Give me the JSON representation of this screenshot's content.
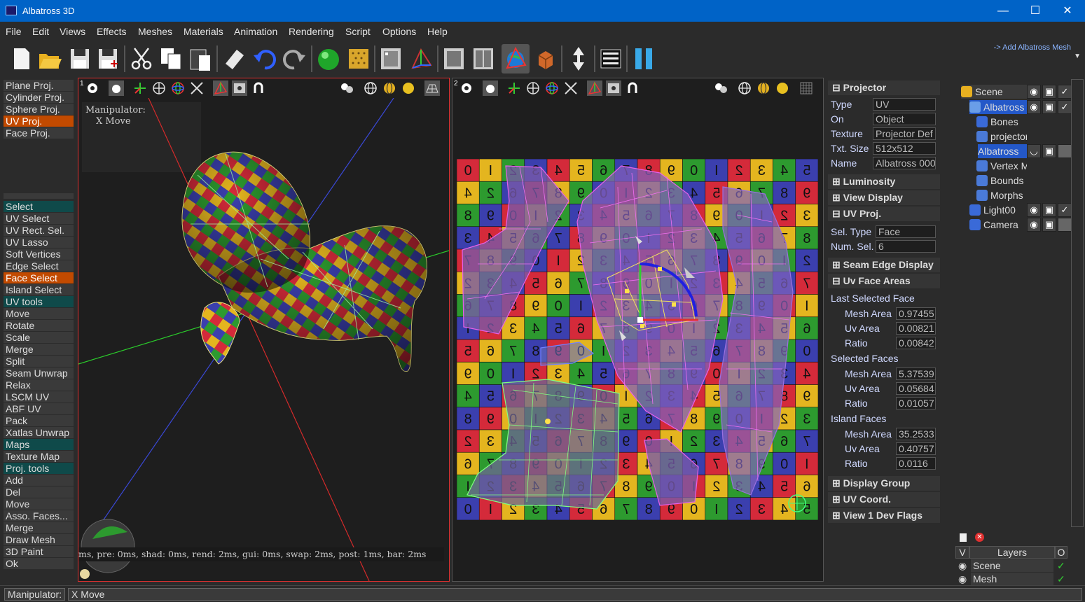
{
  "window": {
    "title": "Albatross 3D",
    "minimize": "—",
    "maximize": "☐",
    "close": "✕"
  },
  "menu": [
    "File",
    "Edit",
    "Views",
    "Effects",
    "Meshes",
    "Materials",
    "Animation",
    "Rendering",
    "Script",
    "Options",
    "Help"
  ],
  "toolbar": {
    "add_mesh_link": "-> Add Albatross Mesh",
    "overflow_arrow": "▼"
  },
  "left_panel": {
    "proj_items": [
      "Plane Proj.",
      "Cylinder Proj.",
      "Sphere Proj.",
      "UV Proj.",
      "Face Proj."
    ],
    "proj_selected": "UV Proj.",
    "select_header": "Select",
    "select_items": [
      "UV Select",
      "UV Rect. Sel.",
      "UV Lasso",
      "Soft Vertices",
      "Edge Select",
      "Face Select",
      "Island Select"
    ],
    "select_selected": "Face Select",
    "uvtools_header": "UV tools",
    "uvtools_items": [
      "Move",
      "Rotate",
      "Scale",
      "Merge",
      "Split",
      "Seam Unwrap",
      "Relax",
      "LSCM UV",
      "ABF UV",
      "Pack",
      "Xatlas Unwrap"
    ],
    "maps_header": "Maps",
    "maps_items": [
      "Texture Map"
    ],
    "projtools_header": "Proj. tools",
    "projtools_items": [
      "Add",
      "Del",
      "Move",
      "Asso. Faces...",
      "Merge",
      "Draw Mesh",
      "3D Paint",
      "Ok"
    ]
  },
  "viewport1": {
    "number": "1",
    "manipulator_label": "Manipulator:",
    "manipulator_value": "X Move",
    "timing": "ms, pre: 0ms, shad: 0ms, rend: 2ms, gui: 0ms, swap: 2ms, post: 1ms, bar: 2ms"
  },
  "viewport2": {
    "number": "2",
    "uv_grid_rows": [
      [
        "0",
        "I",
        "2",
        "3",
        "4",
        "5",
        "6",
        "7",
        "8",
        "9",
        "0",
        "I",
        "2",
        "3",
        "4",
        "5"
      ],
      [
        "4",
        "2",
        "6",
        "7",
        "8",
        "9",
        "0",
        "I",
        "2",
        "3",
        "4",
        "5",
        "6",
        "7",
        "8",
        "9"
      ],
      [
        "8",
        "9",
        "0",
        "I",
        "2",
        "3",
        "4",
        "5",
        "6",
        "7",
        "8",
        "9",
        "0",
        "I",
        "2",
        "3"
      ],
      [
        "3",
        "4",
        "5",
        "6",
        "7",
        "8",
        "9",
        "0",
        "I",
        "2",
        "3",
        "4",
        "5",
        "6",
        "7",
        "8"
      ],
      [
        "7",
        "8",
        "9",
        "0",
        "I",
        "2",
        "3",
        "4",
        "5",
        "6",
        "7",
        "8",
        "9",
        "0",
        "I",
        "2"
      ],
      [
        "2",
        "3",
        "4",
        "5",
        "6",
        "7",
        "8",
        "9",
        "0",
        "I",
        "2",
        "3",
        "4",
        "5",
        "6",
        "7"
      ],
      [
        "6",
        "7",
        "8",
        "9",
        "0",
        "I",
        "2",
        "3",
        "4",
        "5",
        "6",
        "7",
        "8",
        "9",
        "0",
        "I"
      ],
      [
        "I",
        "2",
        "3",
        "4",
        "5",
        "6",
        "7",
        "8",
        "9",
        "0",
        "I",
        "2",
        "3",
        "4",
        "5",
        "6"
      ],
      [
        "5",
        "6",
        "7",
        "8",
        "9",
        "0",
        "I",
        "2",
        "3",
        "4",
        "5",
        "6",
        "7",
        "8",
        "9",
        "0"
      ],
      [
        "9",
        "0",
        "I",
        "2",
        "3",
        "4",
        "5",
        "6",
        "7",
        "8",
        "9",
        "0",
        "I",
        "2",
        "3",
        "4"
      ],
      [
        "4",
        "5",
        "6",
        "7",
        "8",
        "9",
        "0",
        "I",
        "2",
        "3",
        "4",
        "5",
        "6",
        "7",
        "8",
        "9"
      ],
      [
        "8",
        "9",
        "0",
        "I",
        "2",
        "3",
        "4",
        "5",
        "6",
        "7",
        "8",
        "9",
        "0",
        "I",
        "2",
        "3"
      ],
      [
        "2",
        "3",
        "4",
        "5",
        "6",
        "7",
        "8",
        "9",
        "0",
        "I",
        "2",
        "3",
        "4",
        "5",
        "6",
        "7"
      ],
      [
        "6",
        "7",
        "8",
        "9",
        "0",
        "I",
        "2",
        "3",
        "4",
        "5",
        "6",
        "7",
        "8",
        "9",
        "0",
        "I"
      ],
      [
        "I",
        "2",
        "3",
        "4",
        "5",
        "6",
        "7",
        "8",
        "9",
        "0",
        "I",
        "2",
        "3",
        "4",
        "5",
        "6"
      ],
      [
        "0",
        "I",
        "2",
        "3",
        "4",
        "5",
        "6",
        "7",
        "8",
        "9",
        "0",
        "I",
        "2",
        "3",
        "4",
        "5"
      ]
    ],
    "uv_colors": [
      "#d42a3a",
      "#e4b51f",
      "#2d9a2f",
      "#3b3fae"
    ]
  },
  "properties": {
    "projector_header": "Projector",
    "type_label": "Type",
    "type_value": "UV",
    "on_label": "On",
    "on_value": "Object",
    "texture_label": "Texture",
    "texture_value": "Projector Def",
    "txtsize_label": "Txt. Size",
    "txtsize_value": "512x512",
    "name_label": "Name",
    "name_value": "Albatross 000",
    "luminosity_header": "Luminosity",
    "viewdisplay_header": "View Display",
    "uvproj_header": "UV Proj.",
    "seltype_label": "Sel. Type",
    "seltype_value": "Face",
    "numsel_label": "Num. Sel.",
    "numsel_value": "6",
    "seamedge_header": "Seam Edge Display",
    "uvfaceareas_header": "Uv Face Areas",
    "last_selected_face": "Last Selected Face",
    "lsf_mesh_label": "Mesh Area",
    "lsf_mesh_value": "0.97455",
    "lsf_uv_label": "Uv Area",
    "lsf_uv_value": "0.00821",
    "lsf_ratio_label": "Ratio",
    "lsf_ratio_value": "0.00842",
    "selected_faces": "Selected Faces",
    "sf_mesh_label": "Mesh Area",
    "sf_mesh_value": "5.37539",
    "sf_uv_label": "Uv Area",
    "sf_uv_value": "0.05684",
    "sf_ratio_label": "Ratio",
    "sf_ratio_value": "0.01057",
    "island_faces": "Island Faces",
    "if_mesh_label": "Mesh Area",
    "if_mesh_value": "35.2533",
    "if_uv_label": "Uv Area",
    "if_uv_value": "0.40757",
    "if_ratio_label": "Ratio",
    "if_ratio_value": "0.0116",
    "displaygroup_header": "Display Group",
    "uvcoord_header": "UV Coord.",
    "devflags_header": "View 1 Dev Flags"
  },
  "scene": {
    "root": "Scene",
    "albatross": "Albatross",
    "bones": "Bones",
    "projector": "projector",
    "albatross_child": "Albatross",
    "vertex": "Vertex M",
    "bounds": "Bounds",
    "morphs": "Morphs",
    "light": "Light00",
    "camera": "Camera"
  },
  "layers": {
    "col_v": "V",
    "col_layers": "Layers",
    "col_o": "O",
    "rows": [
      "Scene",
      "Mesh"
    ]
  },
  "status": {
    "label": "Manipulator:",
    "value": "X Move"
  }
}
